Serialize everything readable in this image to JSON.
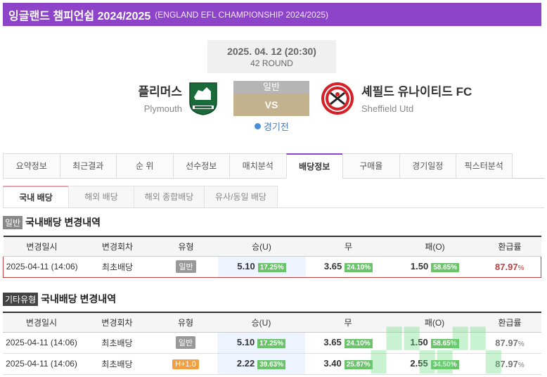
{
  "header": {
    "title": "잉글랜드 챔피언쉽 2024/2025",
    "subtitle": "(ENGLAND EFL CHAMPIONSHIP 2024/2025)"
  },
  "match": {
    "date": "2025. 04. 12 (20:30)",
    "round": "42 ROUND",
    "status": "경기전",
    "vs_top": "일반",
    "vs": "VS",
    "home": {
      "name": "플리머스",
      "name_en": "Plymouth",
      "logo": "plymouth-crest"
    },
    "away": {
      "name": "셰필드 유나이티드 FC",
      "name_en": "Sheffield Utd",
      "logo": "sheffield-utd-crest"
    }
  },
  "tabs": [
    "요약정보",
    "최근결과",
    "순 위",
    "선수정보",
    "매치분석",
    "배당정보",
    "구매율",
    "경기일정",
    "픽스터분석"
  ],
  "active_tab": 5,
  "subtabs": [
    "국내 배당",
    "해외 배당",
    "해외 종합배당",
    "유사/동일 배당"
  ],
  "active_subtab": 0,
  "section1": {
    "tag": "일반",
    "title": "국내배당 변경내역",
    "headers": [
      "변경일시",
      "변경회차",
      "유형",
      "승(U)",
      "무",
      "패(O)",
      "환급률"
    ],
    "rows": [
      {
        "date": "2025-04-11 (14:06)",
        "round": "최초배당",
        "type": "일반",
        "win": "5.10",
        "win_pct": "17.25%",
        "draw": "3.65",
        "draw_pct": "24.10%",
        "lose": "1.50",
        "lose_pct": "58.65%",
        "refund": "87.97",
        "refund_unit": "%"
      }
    ]
  },
  "section2": {
    "tag": "기타유형",
    "title": "국내배당 변경내역",
    "headers": [
      "변경일시",
      "변경회차",
      "유형",
      "승(U)",
      "무",
      "패(O)",
      "환급률"
    ],
    "rows": [
      {
        "date": "2025-04-11 (14:06)",
        "round": "최초배당",
        "type": "일반",
        "win": "5.10",
        "win_pct": "17.25%",
        "draw": "3.65",
        "draw_pct": "24.10%",
        "lose": "1.50",
        "lose_pct": "58.65%",
        "refund": "87.97",
        "refund_unit": "%"
      },
      {
        "date": "2025-04-11 (14:06)",
        "round": "최초배당",
        "type": "H+1.0",
        "win": "2.22",
        "win_pct": "39.63%",
        "draw": "3.40",
        "draw_pct": "25.87%",
        "lose": "2.55",
        "lose_pct": "34.50%",
        "refund": "87.97",
        "refund_unit": "%"
      }
    ]
  },
  "colors": {
    "header_bg": "#8e44c8",
    "pct_bg": "#6bc36b",
    "refund": "#c04040"
  }
}
